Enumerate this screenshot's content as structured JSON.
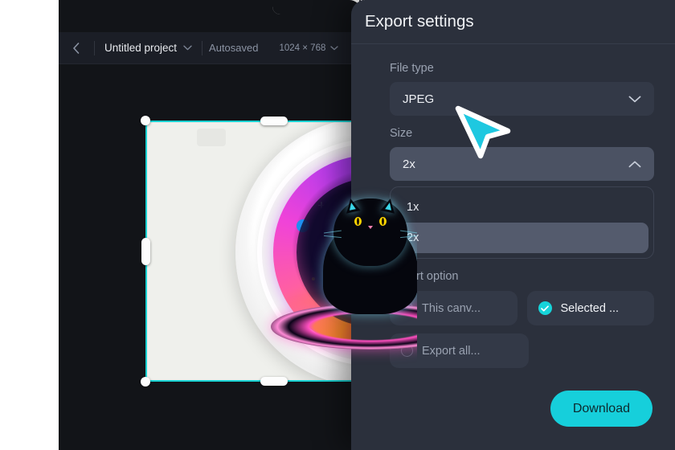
{
  "toolbar": {
    "back_icon": "chevron-left-icon",
    "project_name": "Untitled project",
    "project_chevron": "chevron-down-icon",
    "autosaved_label": "Autosaved",
    "canvas_size": "1024 × 768",
    "size_chevron": "chevron-down-icon",
    "present_icon": "play-icon"
  },
  "canvas": {
    "artwork_name": "galaxy-cat-sticker",
    "selection_color": "#19d2d2",
    "background_color": "#121418"
  },
  "panel": {
    "title": "Export settings",
    "file_type": {
      "label": "File type",
      "value": "JPEG",
      "chevron": "chevron-down-icon"
    },
    "size": {
      "label": "Size",
      "value": "2x",
      "chevron": "chevron-up-icon",
      "options": [
        {
          "label": "1x",
          "selected": false
        },
        {
          "label": "2x",
          "selected": true
        }
      ]
    },
    "export_option": {
      "label": "Export option",
      "choices": [
        {
          "label": "This canv...",
          "selected": false
        },
        {
          "label": "Selected ...",
          "selected": true
        },
        {
          "label": "Export all...",
          "selected": false
        }
      ]
    },
    "download_label": "Download",
    "accent_color": "#16cfdb",
    "background_color": "#2b303c"
  },
  "cursor": {
    "icon": "pointer-cursor",
    "color": "#1ec8e0"
  }
}
